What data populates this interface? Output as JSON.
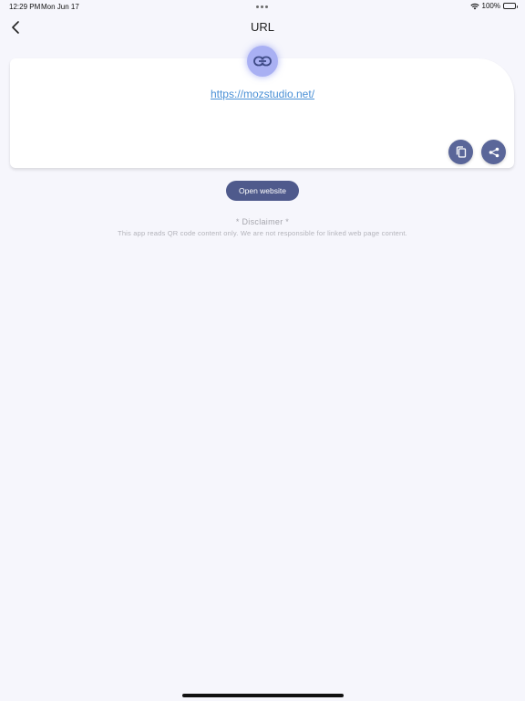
{
  "status_bar": {
    "time": "12:29 PM",
    "date": "Mon Jun 17",
    "battery": "100%",
    "wifi_icon": "wifi-icon",
    "battery_icon": "battery-icon"
  },
  "nav": {
    "title": "URL",
    "back_icon": "chevron-left-icon"
  },
  "card": {
    "type_icon": "link-icon",
    "url": "https://mozstudio.net/",
    "copy_icon": "copy-icon",
    "share_icon": "share-icon"
  },
  "actions": {
    "open_label": "Open website"
  },
  "disclaimer": {
    "title": "* Disclaimer *",
    "text": "This app reads QR code content only. We are not responsible for linked web page content."
  },
  "colors": {
    "background": "#f6f6fc",
    "accent": "#4f5a8c",
    "fab": "#5a6699",
    "badge": "#a9b0f3",
    "link": "#4a90d6"
  }
}
